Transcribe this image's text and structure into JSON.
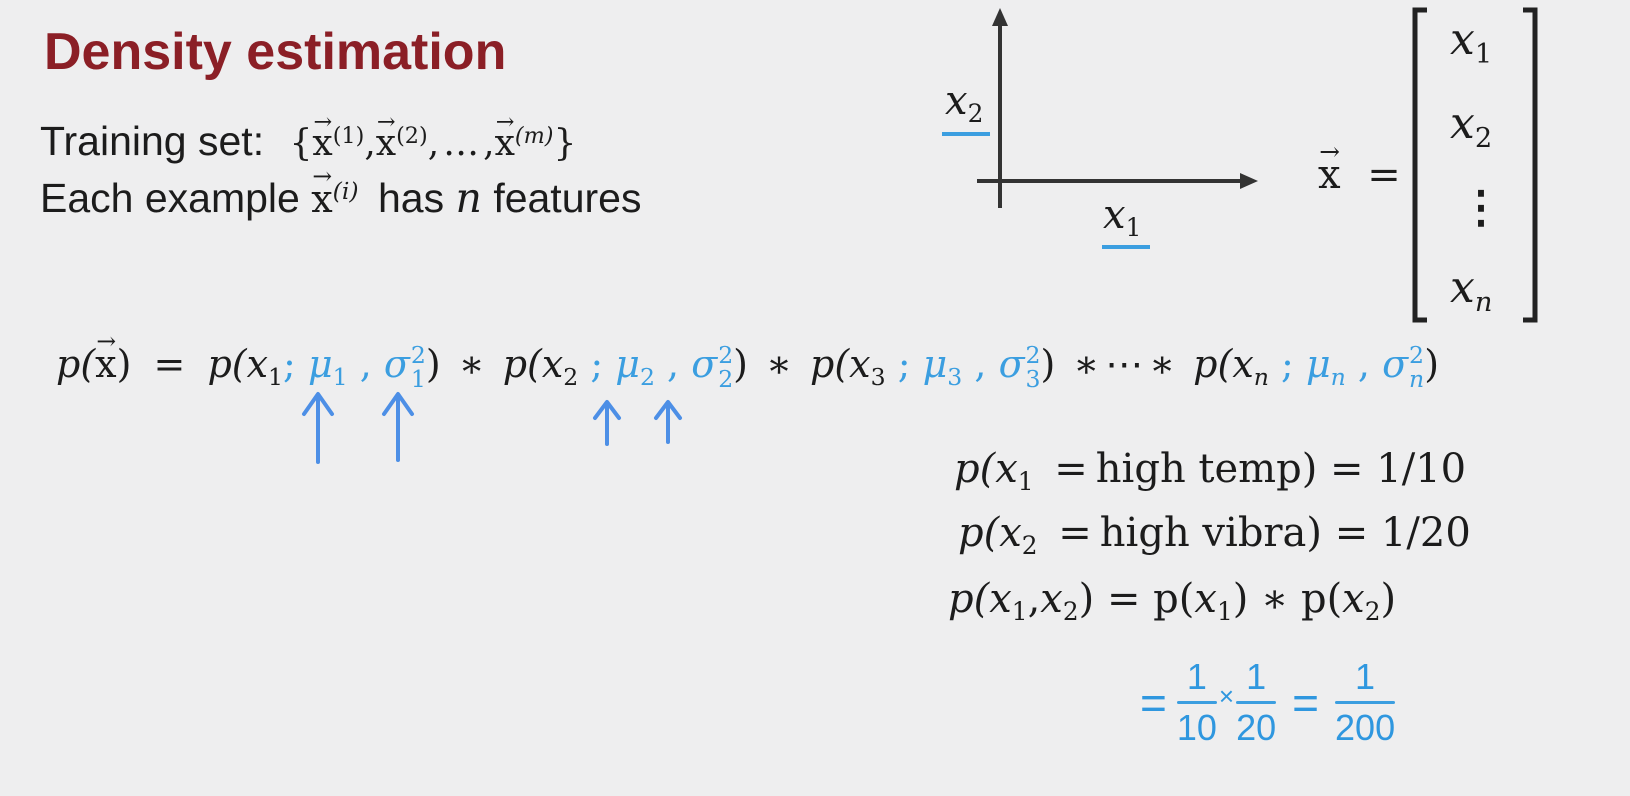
{
  "title": "Density estimation",
  "training": {
    "label": "Training set:",
    "open": "{",
    "x": "x",
    "sup1": "(1)",
    "sup2": "(2)",
    "sup_m": "(m)",
    "comma": ",",
    "ellipsis": "…",
    "close": "}"
  },
  "each_example": {
    "prefix": "Each example",
    "x": "x",
    "sup_i": "(i)",
    "has": "has",
    "n": "n",
    "features": "features"
  },
  "axes": {
    "x2_label": "x",
    "x2_sub": "2",
    "x1_label": "x",
    "x1_sub": "1"
  },
  "vector": {
    "lhs": "x",
    "equals": "=",
    "items": [
      {
        "base": "x",
        "sub": "1"
      },
      {
        "base": "x",
        "sub": "2"
      },
      {
        "base": "⋮",
        "sub": ""
      },
      {
        "base": "x",
        "sub": "n"
      }
    ]
  },
  "product": {
    "lhs_p": "p(",
    "lhs_x": "x",
    "lhs_close": ")",
    "equals": "=",
    "terms": [
      {
        "p": "p(",
        "x": "x",
        "i": "1",
        "mu": "μ",
        "sigma": "σ",
        "sq": "2",
        "close": ")"
      },
      {
        "p": "p(",
        "x": "x",
        "i": "2",
        "mu": "μ",
        "sigma": "σ",
        "sq": "2",
        "close": ")"
      },
      {
        "p": "p(",
        "x": "x",
        "i": "3",
        "mu": "μ",
        "sigma": "σ",
        "sq": "2",
        "close": ")"
      },
      {
        "p": "p(",
        "x": "x",
        "i": "n",
        "mu": "μ",
        "sigma": "σ",
        "sq": "2",
        "close": ")"
      }
    ],
    "times": "∗",
    "dots": "⋯",
    "semicolon": ";",
    "comma": ","
  },
  "examples": {
    "line1": {
      "p": "p(",
      "x": "x",
      "sub": "1",
      "eq": "=",
      "text": "high temp",
      "rest": ") = 1/10"
    },
    "line2": {
      "p": "p(",
      "x": "x",
      "sub": "2",
      "eq": "=",
      "text": "high vibra",
      "rest": ") = 1/20"
    },
    "line3": {
      "p": "p(",
      "x": "x",
      "sub1": "1",
      "comma": ",",
      "sub2": "2",
      "mid": ") = p(",
      "close1": ") ∗ p(",
      "end": ")"
    }
  },
  "handwritten": {
    "eq": "=",
    "one": "1",
    "d1": "10",
    "times": "×",
    "d2": "20",
    "d3": "200"
  },
  "colors": {
    "title": "#8b1f26",
    "accent_blue": "#3b9ee0",
    "arrow_blue": "#4d8fe6"
  }
}
